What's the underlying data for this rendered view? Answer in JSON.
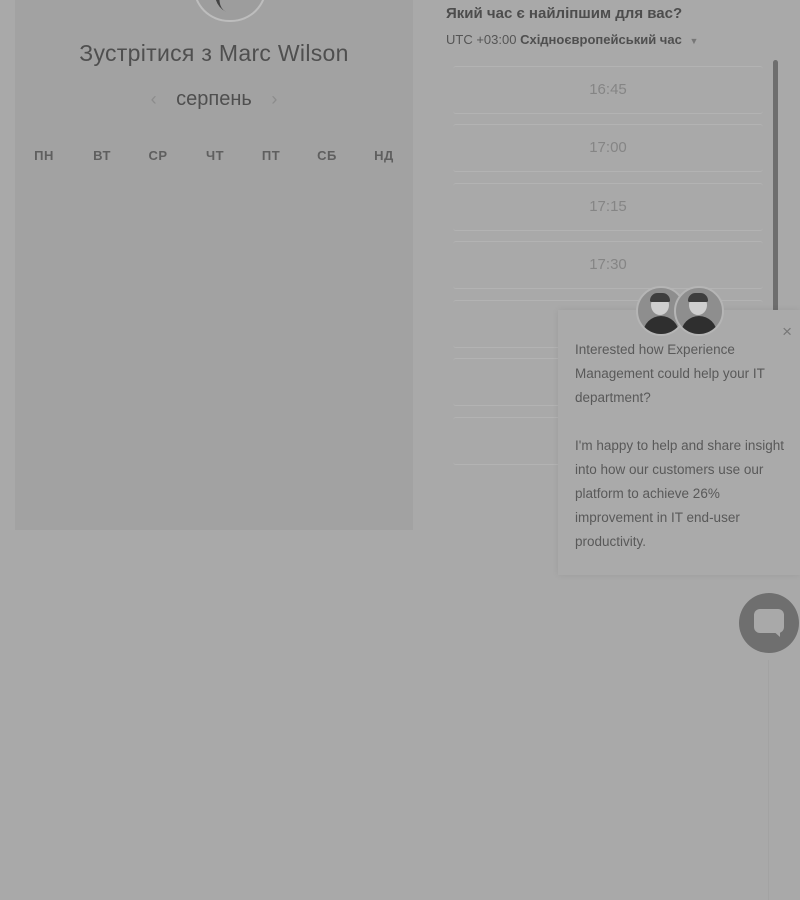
{
  "calendar": {
    "title": "Зустрітися з Marc Wilson",
    "month": "серпень",
    "prev_arrow": "‹",
    "next_arrow": "›",
    "weekdays": [
      "ПН",
      "ВТ",
      "СР",
      "ЧТ",
      "ПТ",
      "СБ",
      "НД"
    ]
  },
  "time_panel": {
    "question": "Який час є найліпшим для вас?",
    "timezone_offset": "UTC +03:00",
    "timezone_name": "Східноєвропейський час",
    "slots": [
      "16:45",
      "17:00",
      "17:15",
      "17:30"
    ]
  },
  "popup": {
    "close_label": "×",
    "paragraph1": "Interested how Experience Management could help your IT department?",
    "paragraph2": "I'm happy to help and share insight into how our customers use our platform to achieve 26% improvement in IT end-user productivity."
  },
  "colors": {
    "overlay_gray": "#a9a9a9",
    "card_gray": "#a2a2a2"
  }
}
